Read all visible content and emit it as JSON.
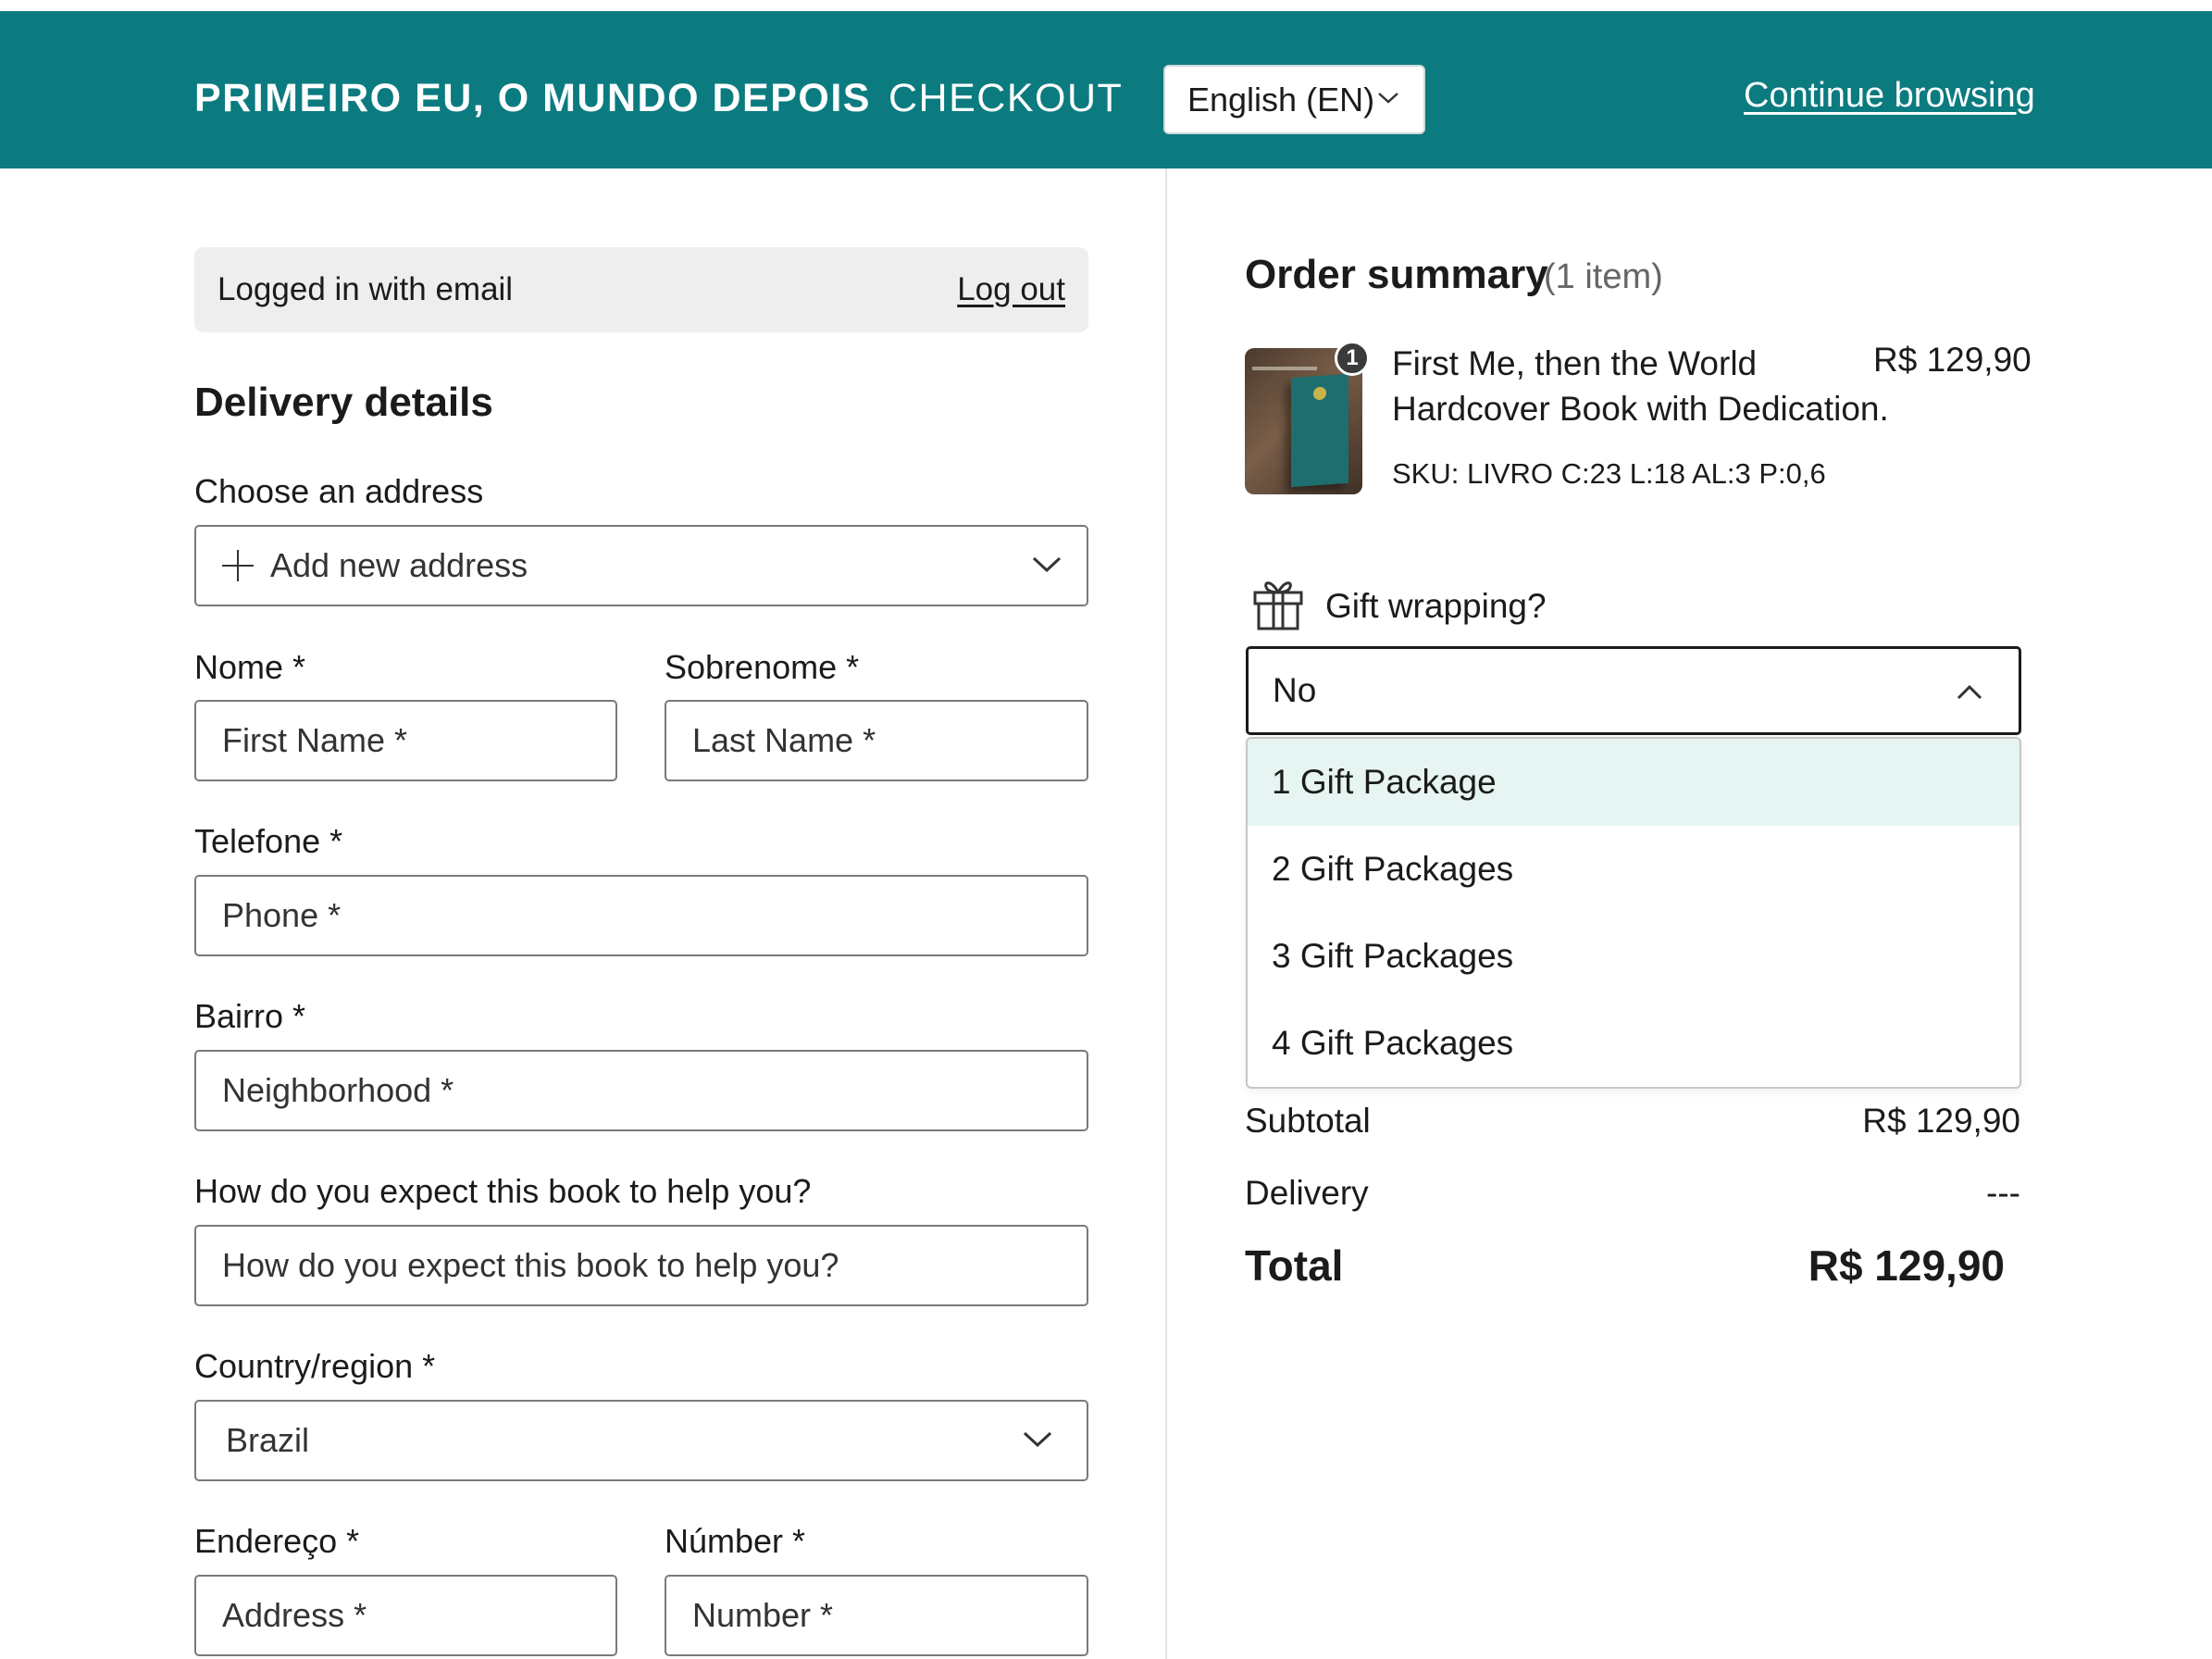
{
  "header": {
    "brand": "PRIMEIRO EU, O MUNDO DEPOIS",
    "section": "CHECKOUT",
    "language": "English (EN)",
    "continue_link": "Continue browsing"
  },
  "account": {
    "logged_text": "Logged in with email",
    "logout_label": "Log out"
  },
  "delivery": {
    "title": "Delivery details",
    "address_label": "Choose an address",
    "address_value": "Add new address",
    "first_name_label": "Nome *",
    "first_name_placeholder": "First Name *",
    "last_name_label": "Sobrenome *",
    "last_name_placeholder": "Last Name *",
    "phone_label": "Telefone *",
    "phone_placeholder": "Phone *",
    "neighborhood_label": "Bairro *",
    "neighborhood_placeholder": "Neighborhood *",
    "question_label": "How do you expect this book to help you?",
    "question_placeholder": "How do you expect this book to help you?",
    "country_label": "Country/region *",
    "country_value": "Brazil",
    "address_field_label": "Endereço *",
    "address_field_placeholder": "Address *",
    "number_label": "Númber *",
    "number_placeholder": "Number *"
  },
  "summary": {
    "title": "Order summary",
    "count": "(1 item)",
    "item": {
      "quantity": "1",
      "name": "First Me, then the World Hardcover Book with Dedication.",
      "price": "R$ 129,90",
      "sku": "SKU: LIVRO C:23 L:18 AL:3 P:0,6"
    },
    "gift_label": "Gift wrapping?",
    "gift_selected": "No",
    "gift_options": [
      "1 Gift Package",
      "2 Gift Packages",
      "3 Gift Packages",
      "4 Gift Packages"
    ],
    "subtotal_label": "Subtotal",
    "subtotal_value": "R$ 129,90",
    "delivery_label": "Delivery",
    "delivery_value": "---",
    "total_label": "Total",
    "total_value": "R$ 129,90"
  },
  "colors": {
    "header_bg": "#0b7b80",
    "option_highlight": "#e6f4f2",
    "info_bar_bg": "#eeeeee"
  }
}
